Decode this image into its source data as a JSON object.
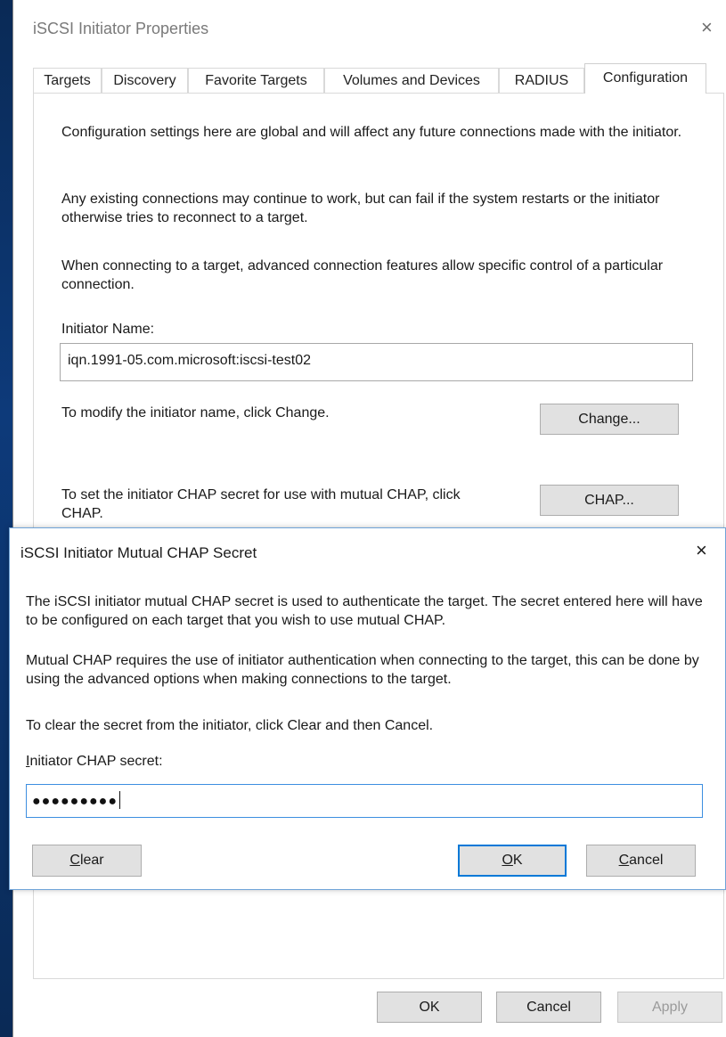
{
  "parent": {
    "title": "iSCSI Initiator Properties",
    "tabs": [
      {
        "label": "Targets"
      },
      {
        "label": "Discovery"
      },
      {
        "label": "Favorite Targets"
      },
      {
        "label": "Volumes and Devices"
      },
      {
        "label": "RADIUS"
      },
      {
        "label": "Configuration"
      }
    ],
    "active_tab": "Configuration",
    "paragraph1": "Configuration settings here are global and will affect any future connections made with the initiator.",
    "paragraph2": "Any existing connections may continue to work, but can fail if the system restarts or the initiator otherwise tries to reconnect to a target.",
    "paragraph3": "When connecting to a target, advanced connection features allow specific control of a particular connection.",
    "initiator_name_label": "Initiator Name:",
    "initiator_name_value": "iqn.1991-05.com.microsoft:iscsi-test02",
    "change_text": "To modify the initiator name, click Change.",
    "change_button": "Change...",
    "chap_text": "To set the initiator CHAP secret for use with mutual CHAP, click CHAP.",
    "chap_button": "CHAP...",
    "ok_button": "OK",
    "cancel_button": "Cancel",
    "apply_button": "Apply"
  },
  "modal": {
    "title": "iSCSI Initiator Mutual CHAP Secret",
    "paragraph1": "The iSCSI initiator mutual CHAP secret is used to authenticate the target.  The secret entered here will have to be configured on each target that you wish to use mutual CHAP.",
    "paragraph2": "Mutual CHAP requires the use of initiator authentication when connecting to the target, this can be done by using the advanced options when making connections to the target.",
    "paragraph3": "To clear the secret from the initiator, click Clear and then Cancel.",
    "secret_label_mnemonic": "I",
    "secret_label_rest": "nitiator CHAP secret:",
    "secret_value": "●●●●●●●●●",
    "clear_mnemonic": "C",
    "clear_rest": "lear",
    "ok_mnemonic": "O",
    "ok_rest": "K",
    "cancel_mnemonic": "C",
    "cancel_rest": "ancel"
  },
  "icons": {
    "close": "×"
  }
}
